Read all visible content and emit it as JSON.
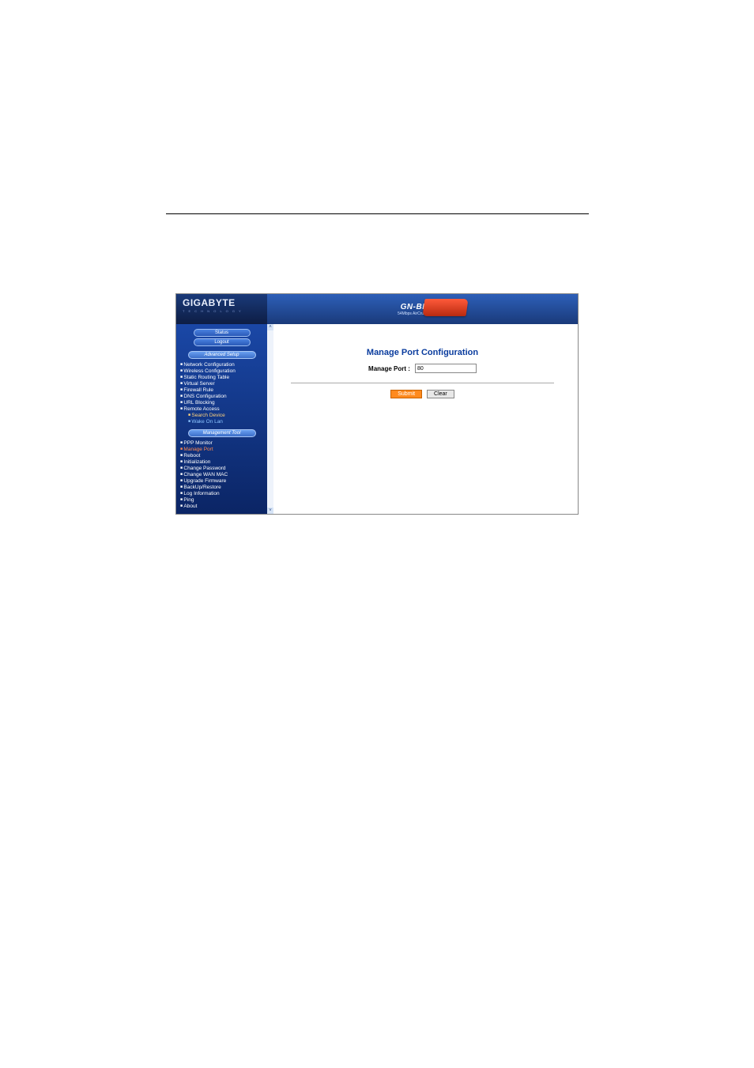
{
  "header": {
    "brand": "GIGABYTE",
    "brand_sub": "T E C H N O L O G Y",
    "model": "GN-BR01G",
    "model_sub": "54Mbps AirCruiser G Router"
  },
  "sidebar": {
    "btn_status": "Status",
    "btn_logout": "Logout",
    "section_advanced": "Advanced Setup",
    "adv_items": [
      "Network Configuration",
      "Wireless Configuration",
      "Static Routing Table",
      "Virtual Server",
      "Firewall Rule",
      "DNS Configuration",
      "URL Blocking",
      "Remote Access"
    ],
    "adv_sub1": "Search Device",
    "adv_sub2": "Wake On Lan",
    "section_mgmt": "Management Tool",
    "mgmt_items": [
      "PPP Monitor",
      "Manage Port",
      "Reboot",
      "Initialization",
      "Change Password",
      "Change WAN MAC",
      "Upgrade Firmware",
      "BackUp/Restore",
      "Log Information",
      "Ping",
      "About"
    ],
    "scroll_up": "˄",
    "scroll_down": "˅"
  },
  "content": {
    "title": "Manage Port Configuration",
    "label": "Manage Port :",
    "value": "80",
    "submit": "Submit",
    "clear": "Clear"
  }
}
